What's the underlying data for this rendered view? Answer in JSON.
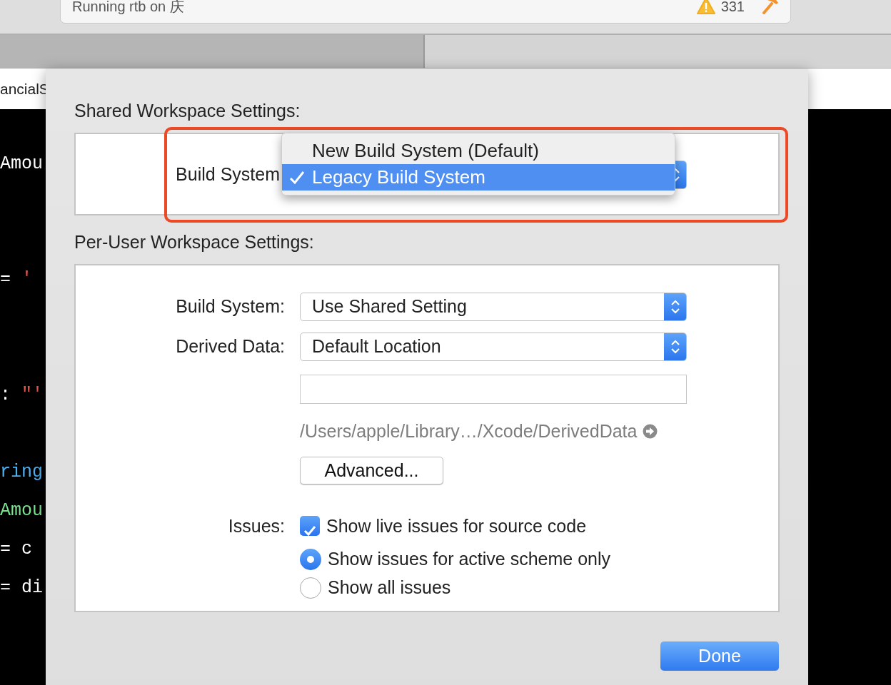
{
  "toolbar": {
    "status": "Running rtb on 庆",
    "warning_count": "331"
  },
  "jump_bar": {
    "text": "ancialS"
  },
  "code_lines": [
    [
      {
        "text": "Amou",
        "color": "#ffffff"
      }
    ],
    [
      {
        "text": "= ",
        "color": "#ffffff"
      },
      {
        "text": "'",
        "color": "#e5544a"
      }
    ],
    [
      {
        "text": ": ",
        "color": "#ffffff"
      },
      {
        "text": "\"'",
        "color": "#e5544a"
      }
    ],
    [
      {
        "text": "ring",
        "color": "#4eb0f0"
      }
    ],
    [
      {
        "text": "Amou",
        "color": "#79e28f"
      }
    ],
    [
      {
        "text": "= c",
        "color": "#ffffff"
      }
    ],
    [
      {
        "text": "= di",
        "color": "#ffffff"
      }
    ]
  ],
  "dialog": {
    "shared_heading": "Shared Workspace Settings:",
    "shared_build_system": {
      "label": "Build System",
      "menu": [
        {
          "label": "New Build System (Default)",
          "selected": false
        },
        {
          "label": "Legacy Build System",
          "selected": true
        }
      ]
    },
    "per_user_heading": "Per-User Workspace Settings:",
    "fields": [
      {
        "label": "Build System:",
        "value": "Use Shared Setting"
      },
      {
        "label": "Derived Data:",
        "value": "Default Location"
      }
    ],
    "path": "/Users/apple/Library…/Xcode/DerivedData",
    "advanced_button": "Advanced...",
    "issues": {
      "label": "Issues:",
      "options": [
        {
          "kind": "checkbox",
          "label": "Show live issues for source code",
          "checked": true
        },
        {
          "kind": "radio",
          "label": "Show issues for active scheme only",
          "selected": true
        },
        {
          "kind": "radio",
          "label": "Show all issues",
          "selected": false
        }
      ]
    },
    "done_button": "Done"
  }
}
